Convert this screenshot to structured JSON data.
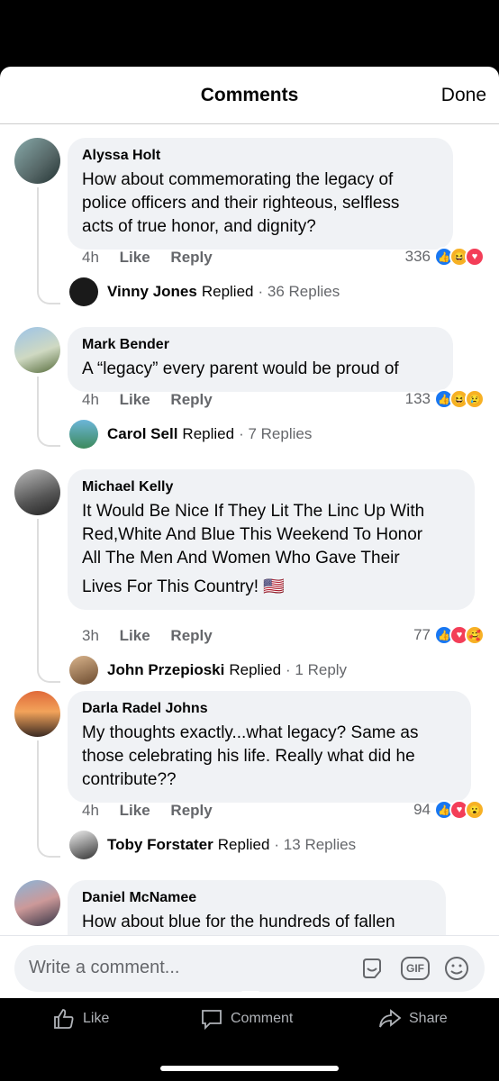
{
  "header": {
    "title": "Comments",
    "done_label": "Done"
  },
  "comments": [
    {
      "name": "Alyssa Holt",
      "text": [
        "How about commemorating the legacy of",
        "police officers and their righteous, selfless",
        "acts of true honor, and dignity?"
      ],
      "time": "4h",
      "like_label": "Like",
      "reply_label": "Reply",
      "reaction_count": "336",
      "reactions": [
        "like",
        "haha",
        "love"
      ],
      "reply": {
        "name": "Vinny Jones",
        "verb": "Replied",
        "count": "· 36 Replies"
      }
    },
    {
      "name": "Mark Bender",
      "text": [
        "A “legacy” every parent would be proud of"
      ],
      "time": "4h",
      "like_label": "Like",
      "reply_label": "Reply",
      "reaction_count": "133",
      "reactions": [
        "like",
        "haha",
        "sad"
      ],
      "reply": {
        "name": "Carol Sell",
        "verb": "Replied",
        "count": "· 7 Replies"
      }
    },
    {
      "name": "Michael Kelly",
      "text": [
        "It Would Be Nice If They Lit The Linc Up With",
        "Red,White And Blue This Weekend To Honor",
        "All The Men And Women Who Gave Their",
        "Lives For This Country! 🇺🇸"
      ],
      "time": "3h",
      "like_label": "Like",
      "reply_label": "Reply",
      "reaction_count": "77",
      "reactions": [
        "like",
        "love",
        "haha"
      ],
      "reply": {
        "name": "John Przepioski",
        "verb": "Replied",
        "count": "· 1 Reply"
      }
    },
    {
      "name": "Darla Radel Johns",
      "text": [
        "My thoughts exactly...what legacy?  Same as",
        "those celebrating his life. Really what did he",
        "contribute??"
      ],
      "time": "4h",
      "like_label": "Like",
      "reply_label": "Reply",
      "reaction_count": "94",
      "reactions": [
        "like",
        "love",
        "wow"
      ],
      "reply": {
        "name": "Toby Forstater",
        "verb": "Replied",
        "count": "· 13 Replies"
      }
    },
    {
      "name": "Daniel McNamee",
      "text": [
        "How about blue for the hundreds of fallen"
      ]
    }
  ],
  "composer": {
    "placeholder": "Write a comment...",
    "gif_label": "GIF"
  },
  "footer": {
    "like_label": "Like",
    "comment_label": "Comment",
    "share_label": "Share"
  },
  "colors": {
    "accent": "#1877f2",
    "bubble": "#f0f2f5",
    "meta": "#65676b"
  }
}
